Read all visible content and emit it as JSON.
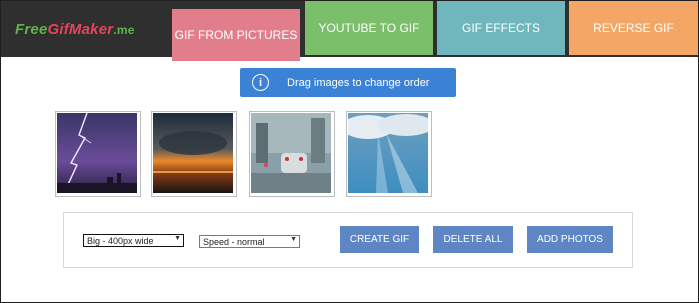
{
  "logo": {
    "part1": "Free",
    "part2": "GifMaker",
    "part3": ".me"
  },
  "tabs": [
    {
      "label": "GIF FROM PICTURES",
      "color": "#e27e8c",
      "active": true
    },
    {
      "label": "YOUTUBE TO GIF",
      "color": "#7cbf6a"
    },
    {
      "label": "GIF EFFECTS",
      "color": "#6fb7bd"
    },
    {
      "label": "REVERSE GIF",
      "color": "#f3a665"
    }
  ],
  "hint": {
    "icon": "info-icon",
    "text": "Drag images to change order"
  },
  "thumbnails": [
    {
      "icon": "lightning-storm-photo"
    },
    {
      "icon": "sunset-storm-photo"
    },
    {
      "icon": "rainy-window-cars-photo"
    },
    {
      "icon": "sky-sunbeams-photo"
    }
  ],
  "controls": {
    "size_select": "Big - 400px wide",
    "speed_select": "Speed - normal",
    "create_label": "CREATE GIF",
    "delete_label": "DELETE ALL",
    "add_label": "ADD PHOTOS"
  }
}
